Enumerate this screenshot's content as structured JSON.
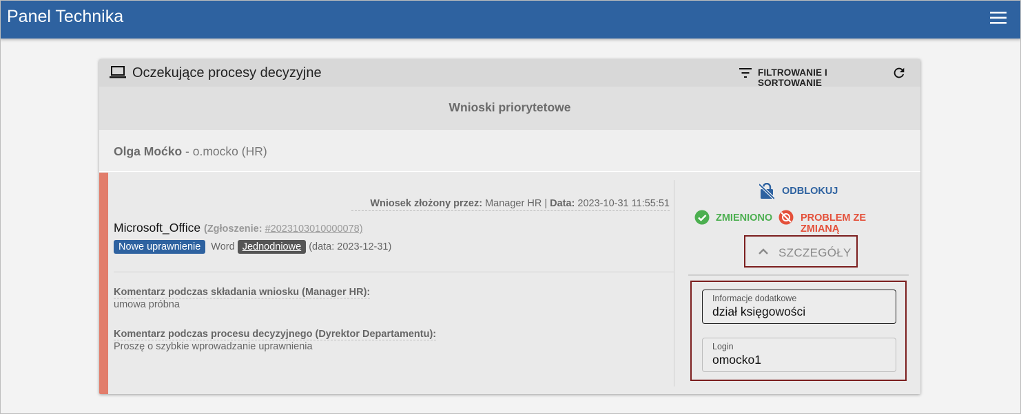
{
  "app": {
    "title": "Panel Technika"
  },
  "card": {
    "title": "Oczekujące procesy decyzyjne",
    "filter_label": "FILTROWANIE I SORTOWANIE"
  },
  "priority": {
    "title": "Wnioski priorytetowe"
  },
  "user": {
    "name": "Olga Moćko",
    "rest": " - o.mocko (HR)"
  },
  "request": {
    "submitted_by_label": "Wniosek złożony przez:",
    "submitted_by_value": " Manager HR | ",
    "date_label": "Data:",
    "date_value": " 2023-10-31 11:55:51",
    "product": "Microsoft_Office",
    "ticket_prefix": "(Zgłoszenie: ",
    "ticket_number": "#2023103010000078)",
    "badge_new": "Nowe uprawnienie",
    "app_name": "Word",
    "badge_type": "Jednodniowe",
    "valid_date": "(data: 2023-12-31)",
    "comment1_label": "Komentarz podczas składania wniosku (Manager HR):",
    "comment1_text": "umowa próbna",
    "comment2_label": "Komentarz podczas procesu decyzyjnego (Dyrektor Departamentu):",
    "comment2_text": "Proszę o szybkie wprowadzanie uprawnienia"
  },
  "actions": {
    "unlock": "ODBLOKUJ",
    "changed": "ZMIENIONO",
    "problem": "PROBLEM ZE ZMIANĄ",
    "details": "SZCZEGÓŁY"
  },
  "details": {
    "info_label": "Informacje dodatkowe",
    "info_value": "dział księgowości",
    "login_label": "Login",
    "login_value": "omocko1"
  },
  "colors": {
    "primary": "#2e62a0",
    "accent_bar": "#e27d6b",
    "success": "#4caf50",
    "danger": "#e4503a",
    "highlight_border": "#7b1e1e"
  }
}
